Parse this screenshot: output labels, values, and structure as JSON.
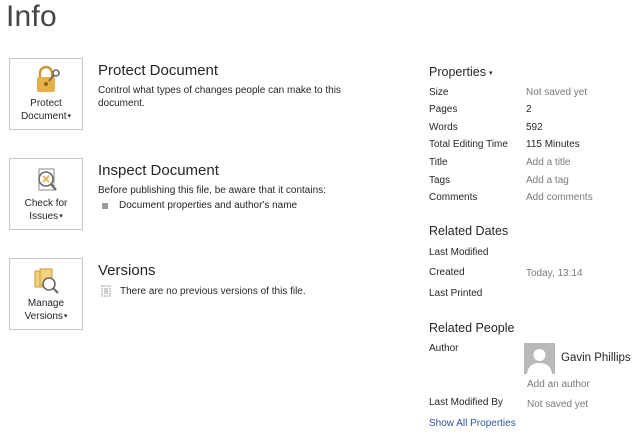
{
  "page": {
    "title": "Info"
  },
  "protect": {
    "button_line1": "Protect",
    "button_line2": "Document",
    "title": "Protect Document",
    "desc": "Control what types of changes people can make to this document."
  },
  "inspect": {
    "button_line1": "Check for",
    "button_line2": "Issues",
    "title": "Inspect Document",
    "desc": "Before publishing this file, be aware that it contains:",
    "items": [
      "Document properties and author's name"
    ]
  },
  "versions": {
    "button_line1": "Manage",
    "button_line2": "Versions",
    "title": "Versions",
    "desc": "There are no previous versions of this file."
  },
  "properties": {
    "header": "Properties",
    "rows": [
      {
        "label": "Size",
        "value": "Not saved yet"
      },
      {
        "label": "Pages",
        "value": "2"
      },
      {
        "label": "Words",
        "value": "592"
      },
      {
        "label": "Total Editing Time",
        "value": "115 Minutes"
      },
      {
        "label": "Title",
        "value": "Add a title"
      },
      {
        "label": "Tags",
        "value": "Add a tag"
      },
      {
        "label": "Comments",
        "value": "Add comments"
      }
    ]
  },
  "related_dates": {
    "header": "Related Dates",
    "last_modified_label": "Last Modified",
    "created_label": "Created",
    "created_value": "Today, 13:14",
    "last_printed_label": "Last Printed"
  },
  "related_people": {
    "header": "Related People",
    "author_label": "Author",
    "author_name": "Gavin Phillips",
    "add_author": "Add an author",
    "last_modified_by_label": "Last Modified By",
    "last_modified_by_value": "Not saved yet"
  },
  "show_all": "Show All Properties",
  "colors": {
    "link": "#2b579a",
    "muted": "#7a7a7a",
    "icon_gold": "#e8b04a"
  }
}
